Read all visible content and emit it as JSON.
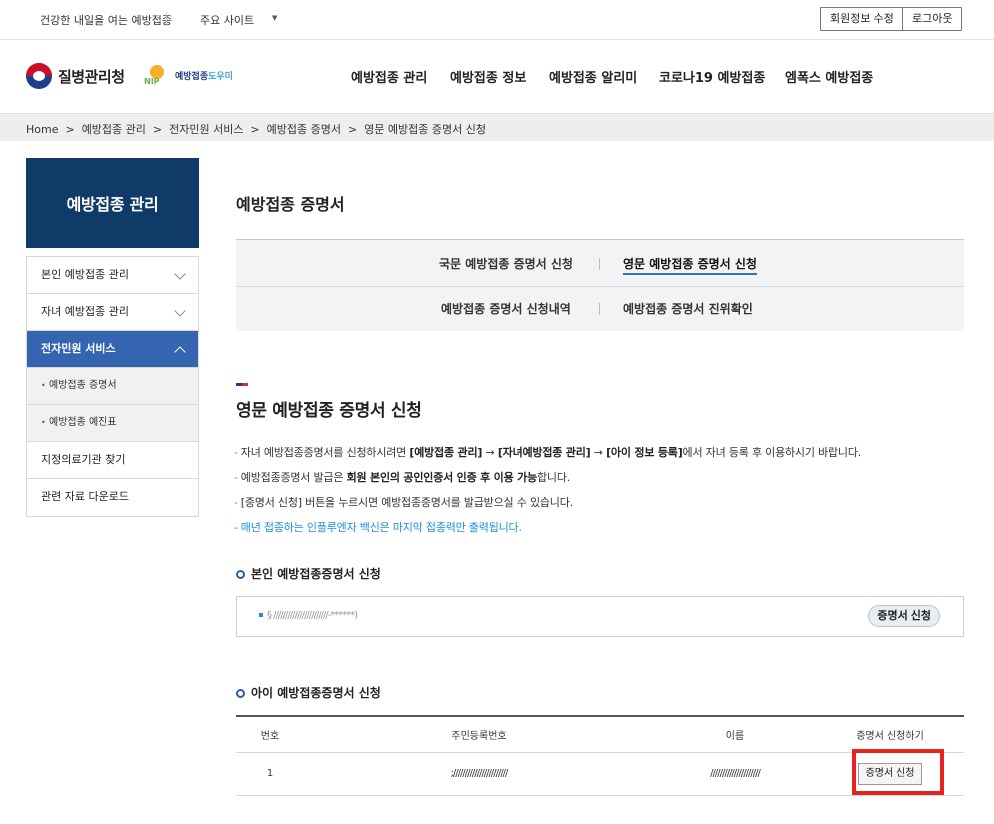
{
  "topbar": {
    "slogan": "건강한 내일을 여는 예방접종",
    "sites": "주요 사이트",
    "sites_caret": "▼",
    "edit_profile": "회원정보 수정",
    "logout": "로그아웃"
  },
  "header": {
    "logo_kdca": "질병관리청",
    "logo_nip_a": "예방접종",
    "logo_nip_b": "도우미",
    "logo_nip_mark": "NIP",
    "nav": [
      "예방접종 관리",
      "예방접종 정보",
      "예방접종 알리미",
      "코로나19 예방접종",
      "엠폭스 예방접종"
    ]
  },
  "breadcrumb": "Home  >  예방접종 관리  >  전자민원 서비스  >  예방접종 증명서  >  영문 예방접종 증명서 신청",
  "sidebar": {
    "title": "예방접종 관리",
    "items": [
      {
        "label": "본인 예방접종 관리"
      },
      {
        "label": "자녀 예방접종 관리"
      },
      {
        "label": "전자민원 서비스"
      },
      {
        "label": "예방접종 증명서"
      },
      {
        "label": "예방접종 예진표"
      },
      {
        "label": "지정의료기관 찾기"
      },
      {
        "label": "관련 자료 다운로드"
      }
    ]
  },
  "main": {
    "page_title": "예방접종 증명서",
    "tabs": [
      {
        "label": "국문 예방접종 증명서 신청"
      },
      {
        "label": "영문 예방접종 증명서 신청"
      },
      {
        "label": "예방접종 증명서 신청내역"
      },
      {
        "label": "예방접종 증명서 진위확인"
      }
    ],
    "section_title": "영문 예방접종 증명서 신청",
    "notes": {
      "n1_a": "자녀 예방접종증명서를 신청하시려면 ",
      "n1_b": "[예방접종 관리]",
      "n1_c": " → ",
      "n1_d": "[자녀예방접종 관리]",
      "n1_e": " → ",
      "n1_f": "[아이 정보 등록]",
      "n1_g": "에서 자녀 등록 후 이용하시기 바랍니다.",
      "n2_a": "예방접종증명서 발급은 ",
      "n2_b": "회원 본인의 공인인증서 인증 후 이용 가능",
      "n2_c": "합니다.",
      "n3": "[증명서 신청] 버튼을 누르시면 예방접종증명서를 발급받으실 수 있습니다.",
      "n4": "매년 접종하는 인플루엔자 백신은 마지막 접종력만 출력됩니다.",
      "dash": "-"
    },
    "self": {
      "heading": "본인 예방접종증명서 신청",
      "info": "§ ///////////////////////-******)",
      "button": "증명서 신청"
    },
    "child": {
      "heading": "아이 예방접종증명서 신청",
      "columns": [
        "번호",
        "주민등록번호",
        "이름",
        "증명서 신청하기"
      ],
      "rows": [
        {
          "no": "1",
          "rrn": ";///////////////////////",
          "name": "/////////////////////",
          "button": "증명서 신청"
        }
      ]
    }
  }
}
